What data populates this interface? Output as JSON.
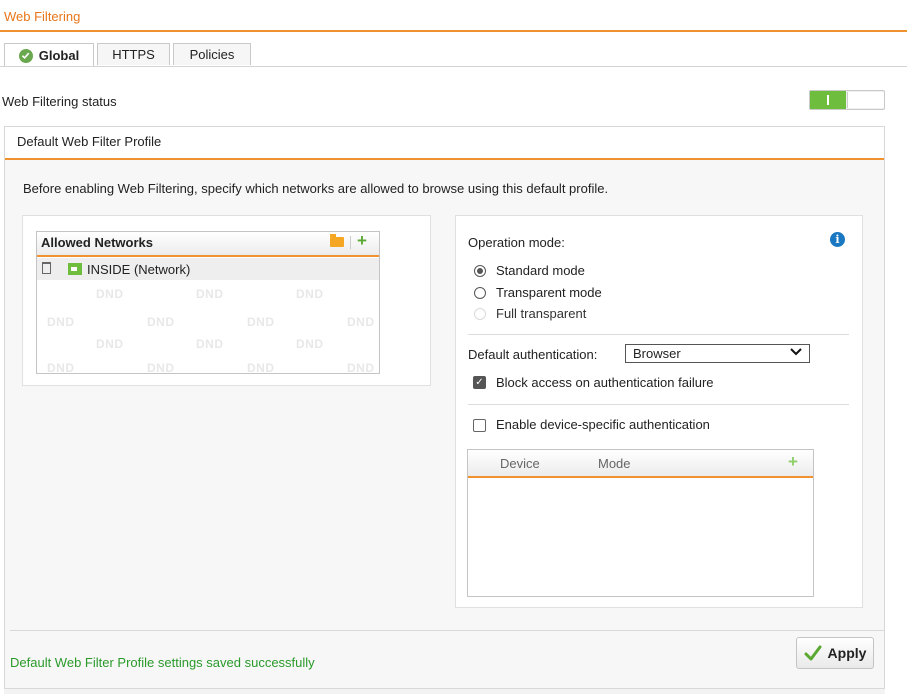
{
  "page": {
    "title": "Web Filtering"
  },
  "tabs": [
    {
      "label": "Global",
      "active": true,
      "icon": "check-circle-icon"
    },
    {
      "label": "HTTPS",
      "active": false
    },
    {
      "label": "Policies",
      "active": false
    }
  ],
  "status": {
    "label": "Web Filtering status",
    "enabled": true,
    "toggle_on_text": "I"
  },
  "profile": {
    "title": "Default Web Filter Profile",
    "info_text": "Before enabling Web Filtering, specify which networks are allowed to browse using this default profile.",
    "allowed_networks": {
      "title": "Allowed Networks",
      "items": [
        {
          "label": "INSIDE (Network)",
          "icon": "network-flag-icon"
        }
      ],
      "placeholder": "DND",
      "add_symbol": "+"
    },
    "operation_mode": {
      "label": "Operation mode:",
      "options": [
        {
          "label": "Standard mode",
          "selected": true,
          "disabled": false
        },
        {
          "label": "Transparent mode",
          "selected": false,
          "disabled": false
        },
        {
          "label": "Full transparent",
          "selected": false,
          "disabled": true
        }
      ]
    },
    "default_authentication": {
      "label": "Default authentication:",
      "value": "Browser"
    },
    "block_access": {
      "label": "Block access on authentication failure",
      "checked": true
    },
    "device_auth": {
      "label": "Enable device-specific authentication",
      "checked": false
    },
    "device_table": {
      "columns": [
        "Device",
        "Mode"
      ],
      "add_symbol": "+"
    }
  },
  "footer": {
    "status_message": "Default Web Filter Profile settings saved successfully",
    "apply_label": "Apply"
  },
  "colors": {
    "accent": "#f0922f",
    "success": "#2b9a2b",
    "toggle_on": "#6ebd3c",
    "info": "#1a78c2"
  }
}
